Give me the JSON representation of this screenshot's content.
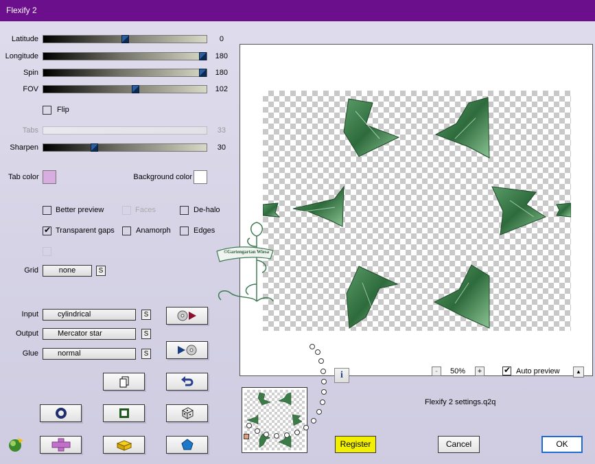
{
  "window": {
    "title": "Flexify 2"
  },
  "sliders": {
    "latitude": {
      "label": "Latitude",
      "value": "0"
    },
    "longitude": {
      "label": "Longitude",
      "value": "180"
    },
    "spin": {
      "label": "Spin",
      "value": "180"
    },
    "fov": {
      "label": "FOV",
      "value": "102"
    },
    "tabs": {
      "label": "Tabs",
      "value": "33"
    },
    "sharpen": {
      "label": "Sharpen",
      "value": "30"
    }
  },
  "flip": {
    "label": "Flip",
    "checked": false
  },
  "colors": {
    "tab_label": "Tab color",
    "tab_color": "#d8aee0",
    "background_label": "Background color",
    "background_color": "#ffffff"
  },
  "options": {
    "better_preview": "Better preview",
    "faces": "Faces",
    "de_halo": "De-halo",
    "transparent_gaps": "Transparent gaps",
    "anamorph": "Anamorph",
    "edges": "Edges"
  },
  "grid": {
    "label": "Grid",
    "value": "none",
    "s": "S"
  },
  "projection": {
    "input_label": "Input",
    "input_value": "cylindrical",
    "output_label": "Output",
    "output_value": "Mercator star",
    "glue_label": "Glue",
    "glue_value": "normal",
    "s": "S"
  },
  "preview_controls": {
    "zoom_minus": "-",
    "zoom": "50%",
    "zoom_plus": "+",
    "auto_preview": "Auto preview",
    "auto_preview_checked": true,
    "expand": "▲",
    "settings_file": "Flexify 2 settings.q2q",
    "info": "i"
  },
  "watermark": {
    "text": "©Gartengartan Wiesa"
  },
  "footer": {
    "register": "Register",
    "cancel": "Cancel",
    "ok": "OK"
  }
}
